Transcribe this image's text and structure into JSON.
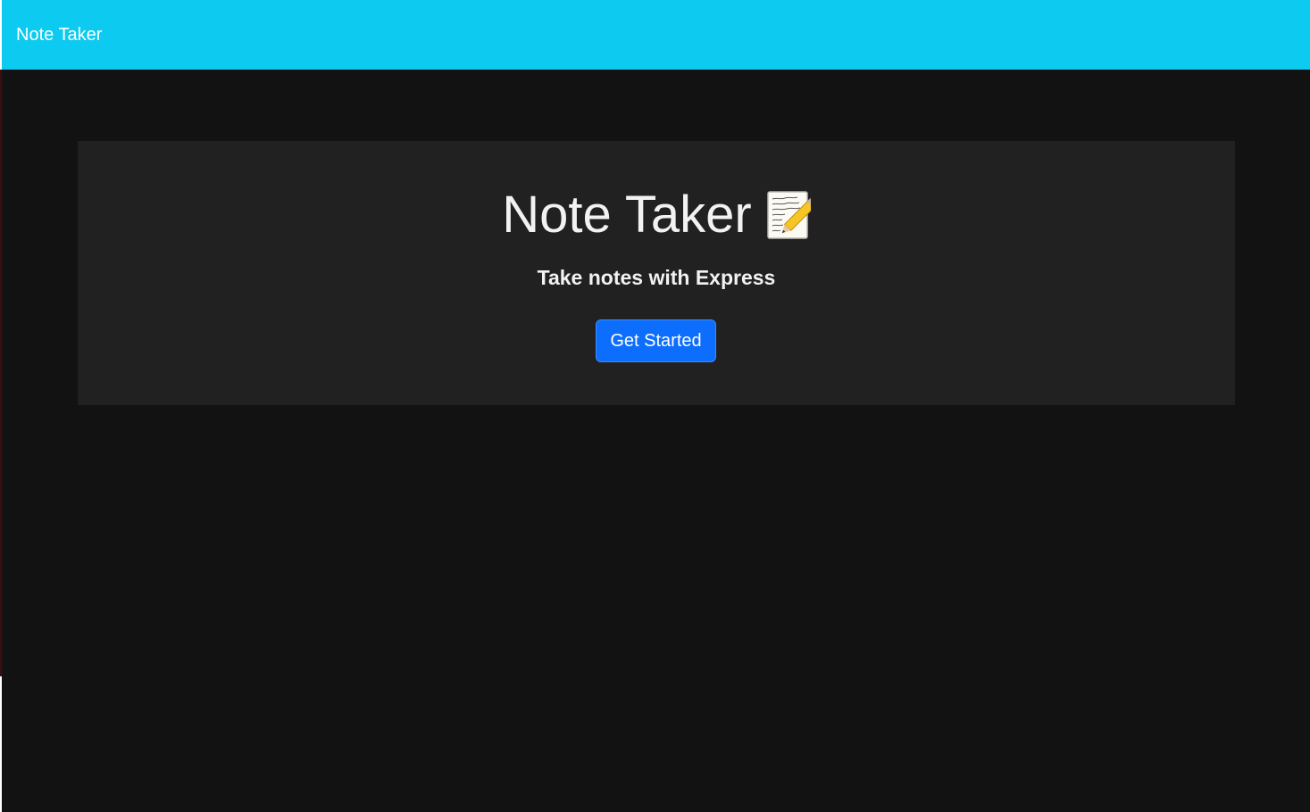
{
  "navbar": {
    "brand": "Note Taker",
    "background": "#0dcaf0"
  },
  "hero": {
    "title": "Note Taker",
    "title_icon": "memo-icon",
    "subtitle": "Take notes with Express",
    "button_label": "Get Started",
    "button_color": "#0d6efd",
    "panel_color": "#212121"
  },
  "page": {
    "background": "#121212"
  }
}
